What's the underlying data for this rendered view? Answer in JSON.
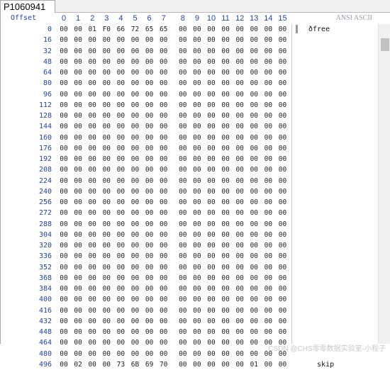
{
  "tab": {
    "label": "P1060941"
  },
  "header": {
    "offset_label": "Offset",
    "columns": [
      "0",
      "1",
      "2",
      "3",
      "4",
      "5",
      "6",
      "7",
      "8",
      "9",
      "10",
      "11",
      "12",
      "13",
      "14",
      "15"
    ],
    "ascii_label": "ANSI ASCII"
  },
  "rows": [
    {
      "offset": "0",
      "bytes": [
        "00",
        "00",
        "01",
        "F0",
        "66",
        "72",
        "65",
        "65",
        "00",
        "00",
        "00",
        "00",
        "00",
        "00",
        "00",
        "00"
      ],
      "ascii": "ðfree"
    },
    {
      "offset": "16",
      "bytes": [
        "00",
        "00",
        "00",
        "00",
        "00",
        "00",
        "00",
        "00",
        "00",
        "00",
        "00",
        "00",
        "00",
        "00",
        "00",
        "00"
      ],
      "ascii": ""
    },
    {
      "offset": "32",
      "bytes": [
        "00",
        "00",
        "00",
        "00",
        "00",
        "00",
        "00",
        "00",
        "00",
        "00",
        "00",
        "00",
        "00",
        "00",
        "00",
        "00"
      ],
      "ascii": ""
    },
    {
      "offset": "48",
      "bytes": [
        "00",
        "00",
        "00",
        "00",
        "00",
        "00",
        "00",
        "00",
        "00",
        "00",
        "00",
        "00",
        "00",
        "00",
        "00",
        "00"
      ],
      "ascii": ""
    },
    {
      "offset": "64",
      "bytes": [
        "00",
        "00",
        "00",
        "00",
        "00",
        "00",
        "00",
        "00",
        "00",
        "00",
        "00",
        "00",
        "00",
        "00",
        "00",
        "00"
      ],
      "ascii": ""
    },
    {
      "offset": "80",
      "bytes": [
        "00",
        "00",
        "00",
        "00",
        "00",
        "00",
        "00",
        "00",
        "00",
        "00",
        "00",
        "00",
        "00",
        "00",
        "00",
        "00"
      ],
      "ascii": ""
    },
    {
      "offset": "96",
      "bytes": [
        "00",
        "00",
        "00",
        "00",
        "00",
        "00",
        "00",
        "00",
        "00",
        "00",
        "00",
        "00",
        "00",
        "00",
        "00",
        "00"
      ],
      "ascii": ""
    },
    {
      "offset": "112",
      "bytes": [
        "00",
        "00",
        "00",
        "00",
        "00",
        "00",
        "00",
        "00",
        "00",
        "00",
        "00",
        "00",
        "00",
        "00",
        "00",
        "00"
      ],
      "ascii": ""
    },
    {
      "offset": "128",
      "bytes": [
        "00",
        "00",
        "00",
        "00",
        "00",
        "00",
        "00",
        "00",
        "00",
        "00",
        "00",
        "00",
        "00",
        "00",
        "00",
        "00"
      ],
      "ascii": ""
    },
    {
      "offset": "144",
      "bytes": [
        "00",
        "00",
        "00",
        "00",
        "00",
        "00",
        "00",
        "00",
        "00",
        "00",
        "00",
        "00",
        "00",
        "00",
        "00",
        "00"
      ],
      "ascii": ""
    },
    {
      "offset": "160",
      "bytes": [
        "00",
        "00",
        "00",
        "00",
        "00",
        "00",
        "00",
        "00",
        "00",
        "00",
        "00",
        "00",
        "00",
        "00",
        "00",
        "00"
      ],
      "ascii": ""
    },
    {
      "offset": "176",
      "bytes": [
        "00",
        "00",
        "00",
        "00",
        "00",
        "00",
        "00",
        "00",
        "00",
        "00",
        "00",
        "00",
        "00",
        "00",
        "00",
        "00"
      ],
      "ascii": ""
    },
    {
      "offset": "192",
      "bytes": [
        "00",
        "00",
        "00",
        "00",
        "00",
        "00",
        "00",
        "00",
        "00",
        "00",
        "00",
        "00",
        "00",
        "00",
        "00",
        "00"
      ],
      "ascii": ""
    },
    {
      "offset": "208",
      "bytes": [
        "00",
        "00",
        "00",
        "00",
        "00",
        "00",
        "00",
        "00",
        "00",
        "00",
        "00",
        "00",
        "00",
        "00",
        "00",
        "00"
      ],
      "ascii": ""
    },
    {
      "offset": "224",
      "bytes": [
        "00",
        "00",
        "00",
        "00",
        "00",
        "00",
        "00",
        "00",
        "00",
        "00",
        "00",
        "00",
        "00",
        "00",
        "00",
        "00"
      ],
      "ascii": ""
    },
    {
      "offset": "240",
      "bytes": [
        "00",
        "00",
        "00",
        "00",
        "00",
        "00",
        "00",
        "00",
        "00",
        "00",
        "00",
        "00",
        "00",
        "00",
        "00",
        "00"
      ],
      "ascii": ""
    },
    {
      "offset": "256",
      "bytes": [
        "00",
        "00",
        "00",
        "00",
        "00",
        "00",
        "00",
        "00",
        "00",
        "00",
        "00",
        "00",
        "00",
        "00",
        "00",
        "00"
      ],
      "ascii": ""
    },
    {
      "offset": "272",
      "bytes": [
        "00",
        "00",
        "00",
        "00",
        "00",
        "00",
        "00",
        "00",
        "00",
        "00",
        "00",
        "00",
        "00",
        "00",
        "00",
        "00"
      ],
      "ascii": ""
    },
    {
      "offset": "288",
      "bytes": [
        "00",
        "00",
        "00",
        "00",
        "00",
        "00",
        "00",
        "00",
        "00",
        "00",
        "00",
        "00",
        "00",
        "00",
        "00",
        "00"
      ],
      "ascii": ""
    },
    {
      "offset": "304",
      "bytes": [
        "00",
        "00",
        "00",
        "00",
        "00",
        "00",
        "00",
        "00",
        "00",
        "00",
        "00",
        "00",
        "00",
        "00",
        "00",
        "00"
      ],
      "ascii": ""
    },
    {
      "offset": "320",
      "bytes": [
        "00",
        "00",
        "00",
        "00",
        "00",
        "00",
        "00",
        "00",
        "00",
        "00",
        "00",
        "00",
        "00",
        "00",
        "00",
        "00"
      ],
      "ascii": ""
    },
    {
      "offset": "336",
      "bytes": [
        "00",
        "00",
        "00",
        "00",
        "00",
        "00",
        "00",
        "00",
        "00",
        "00",
        "00",
        "00",
        "00",
        "00",
        "00",
        "00"
      ],
      "ascii": ""
    },
    {
      "offset": "352",
      "bytes": [
        "00",
        "00",
        "00",
        "00",
        "00",
        "00",
        "00",
        "00",
        "00",
        "00",
        "00",
        "00",
        "00",
        "00",
        "00",
        "00"
      ],
      "ascii": ""
    },
    {
      "offset": "368",
      "bytes": [
        "00",
        "00",
        "00",
        "00",
        "00",
        "00",
        "00",
        "00",
        "00",
        "00",
        "00",
        "00",
        "00",
        "00",
        "00",
        "00"
      ],
      "ascii": ""
    },
    {
      "offset": "384",
      "bytes": [
        "00",
        "00",
        "00",
        "00",
        "00",
        "00",
        "00",
        "00",
        "00",
        "00",
        "00",
        "00",
        "00",
        "00",
        "00",
        "00"
      ],
      "ascii": ""
    },
    {
      "offset": "400",
      "bytes": [
        "00",
        "00",
        "00",
        "00",
        "00",
        "00",
        "00",
        "00",
        "00",
        "00",
        "00",
        "00",
        "00",
        "00",
        "00",
        "00"
      ],
      "ascii": ""
    },
    {
      "offset": "416",
      "bytes": [
        "00",
        "00",
        "00",
        "00",
        "00",
        "00",
        "00",
        "00",
        "00",
        "00",
        "00",
        "00",
        "00",
        "00",
        "00",
        "00"
      ],
      "ascii": ""
    },
    {
      "offset": "432",
      "bytes": [
        "00",
        "00",
        "00",
        "00",
        "00",
        "00",
        "00",
        "00",
        "00",
        "00",
        "00",
        "00",
        "00",
        "00",
        "00",
        "00"
      ],
      "ascii": ""
    },
    {
      "offset": "448",
      "bytes": [
        "00",
        "00",
        "00",
        "00",
        "00",
        "00",
        "00",
        "00",
        "00",
        "00",
        "00",
        "00",
        "00",
        "00",
        "00",
        "00"
      ],
      "ascii": ""
    },
    {
      "offset": "464",
      "bytes": [
        "00",
        "00",
        "00",
        "00",
        "00",
        "00",
        "00",
        "00",
        "00",
        "00",
        "00",
        "00",
        "00",
        "00",
        "00",
        "00"
      ],
      "ascii": ""
    },
    {
      "offset": "480",
      "bytes": [
        "00",
        "00",
        "00",
        "00",
        "00",
        "00",
        "00",
        "00",
        "00",
        "00",
        "00",
        "00",
        "00",
        "00",
        "00",
        "00"
      ],
      "ascii": ""
    },
    {
      "offset": "496",
      "bytes": [
        "00",
        "02",
        "00",
        "00",
        "73",
        "6B",
        "69",
        "70",
        "00",
        "00",
        "00",
        "00",
        "00",
        "01",
        "00",
        "00"
      ],
      "ascii": "  skip"
    }
  ],
  "watermark": "CSDN @CHS零零数据实验室-小程子",
  "colors": {
    "offset": "#2244aa",
    "hex": "#222222",
    "background": "#ffffff"
  }
}
